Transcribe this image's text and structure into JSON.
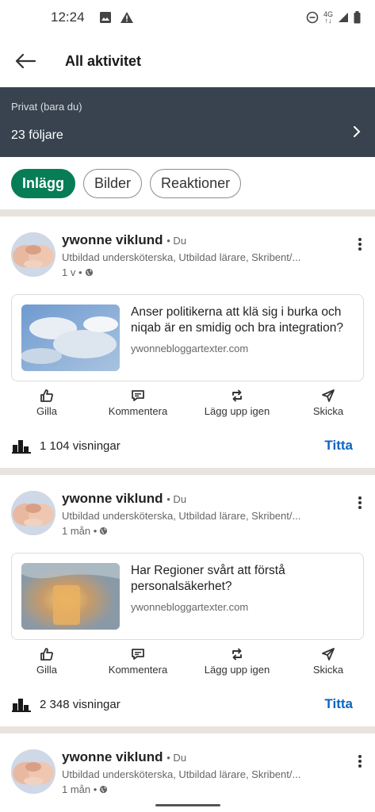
{
  "status": {
    "time": "12:24",
    "network": "4G"
  },
  "header": {
    "title": "All aktivitet"
  },
  "privacy": {
    "label": "Privat (bara du)",
    "followers": "23 följare"
  },
  "filters": [
    {
      "label": "Inlägg",
      "active": true
    },
    {
      "label": "Bilder",
      "active": false
    },
    {
      "label": "Reaktioner",
      "active": false
    }
  ],
  "posts": [
    {
      "author": "ywonne viklund",
      "you": "• Du",
      "headline": "Utbildad undersköterska, Utbildad lärare, Skribent/...",
      "time": "1 v •",
      "card_title": "Anser politikerna att klä sig i burka och niqab är en smidig och bra integration?",
      "card_url": "ywonnebloggartexter.com",
      "views": "1 104 visningar",
      "view_btn": "Titta"
    },
    {
      "author": "ywonne viklund",
      "you": "• Du",
      "headline": "Utbildad undersköterska, Utbildad lärare, Skribent/...",
      "time": "1 mån •",
      "card_title": "Har Regioner svårt att förstå personalsäkerhet?",
      "card_url": "ywonnebloggartexter.com",
      "views": "2 348 visningar",
      "view_btn": "Titta"
    },
    {
      "author": "ywonne viklund",
      "you": "• Du",
      "headline": "Utbildad undersköterska, Utbildad lärare, Skribent/...",
      "time": "1 mån •"
    }
  ],
  "actions": {
    "like": "Gilla",
    "comment": "Kommentera",
    "repost": "Lägg upp igen",
    "send": "Skicka"
  },
  "colors": {
    "accent_green": "#067d56",
    "link_blue": "#0a66c2",
    "banner": "#38434f"
  }
}
